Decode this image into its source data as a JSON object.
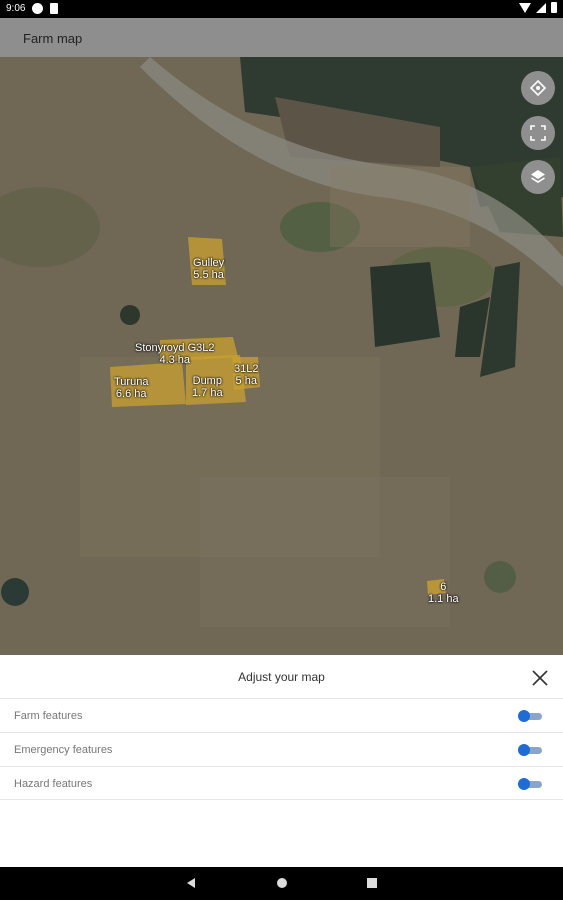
{
  "status_bar": {
    "time": "9:06",
    "icons": [
      "notification-icon",
      "sim-icon",
      "wifi-icon",
      "signal-icon",
      "battery-icon"
    ]
  },
  "app_bar": {
    "title": "Farm map"
  },
  "map": {
    "controls": [
      {
        "name": "my-location-icon"
      },
      {
        "name": "fullscreen-icon"
      },
      {
        "name": "layers-icon"
      }
    ],
    "parcels": [
      {
        "name": "Gulley",
        "area": "5.5 ha"
      },
      {
        "name": "Stonyroyd G3L2",
        "area": "4.3 ha"
      },
      {
        "name": "Turuna",
        "area": "6.6 ha"
      },
      {
        "name": "Dump",
        "area": "1.7 ha"
      },
      {
        "name": "31L2",
        "area": "5 ha"
      },
      {
        "name": "6",
        "area": "1.1 ha"
      }
    ]
  },
  "sheet": {
    "title": "Adjust your map",
    "toggles": [
      {
        "label": "Farm features",
        "on": true
      },
      {
        "label": "Emergency features",
        "on": true
      },
      {
        "label": "Hazard features",
        "on": true
      }
    ]
  },
  "colors": {
    "toggle_on": "#1e6cd4",
    "parcel_fill": "#c9a032",
    "app_bar": "#8e8e8e"
  }
}
